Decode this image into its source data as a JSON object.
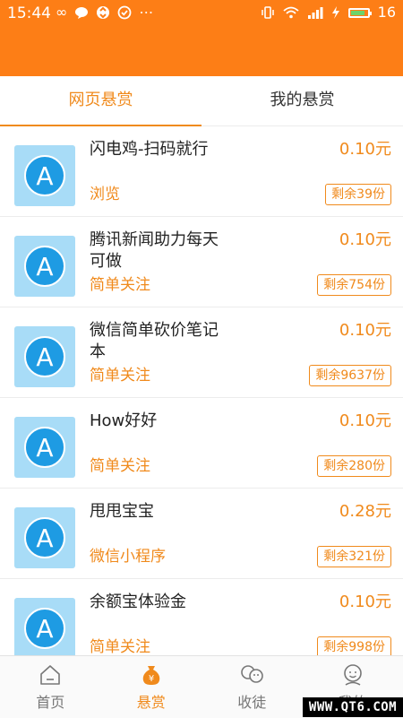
{
  "status_bar": {
    "time": "15:44",
    "battery_level": "16",
    "left_icons": [
      "infinity-icon",
      "chat-bubble-icon",
      "sync-icon",
      "check-circle-icon",
      "more-icon"
    ],
    "right_icons": [
      "vibrate-icon",
      "wifi-icon",
      "signal-icon",
      "charging-icon",
      "battery-icon"
    ]
  },
  "colors": {
    "header": "#fd7e16",
    "accent": "#f08a1c",
    "avatar_bg": "#a8dcf7",
    "avatar_circle": "#1e9be3"
  },
  "tabs": [
    {
      "label": "网页悬赏",
      "active": true
    },
    {
      "label": "我的悬赏",
      "active": false
    }
  ],
  "items": [
    {
      "title": "闪电鸡-扫码就行",
      "price": "0.10元",
      "tag": "浏览",
      "remaining": "剩余39份",
      "avatar": "A"
    },
    {
      "title": "腾讯新闻助力每天可做",
      "price": "0.10元",
      "tag": "简单关注",
      "remaining": "剩余754份",
      "avatar": "A"
    },
    {
      "title": "微信简单砍价笔记本",
      "price": "0.10元",
      "tag": "简单关注",
      "remaining": "剩余9637份",
      "avatar": "A"
    },
    {
      "title": "How好好",
      "price": "0.10元",
      "tag": "简单关注",
      "remaining": "剩余280份",
      "avatar": "A"
    },
    {
      "title": "甩甩宝宝",
      "price": "0.28元",
      "tag": "微信小程序",
      "remaining": "剩余321份",
      "avatar": "A"
    },
    {
      "title": "余额宝体验金",
      "price": "0.10元",
      "tag": "简单关注",
      "remaining": "剩余998份",
      "avatar": "A"
    }
  ],
  "bottom_nav": [
    {
      "label": "首页",
      "icon": "home-icon",
      "active": false
    },
    {
      "label": "悬赏",
      "icon": "money-bag-icon",
      "active": true
    },
    {
      "label": "收徒",
      "icon": "users-icon",
      "active": false
    },
    {
      "label": "我的",
      "icon": "profile-icon",
      "active": false
    }
  ],
  "watermark": "WWW.QT6.COM"
}
